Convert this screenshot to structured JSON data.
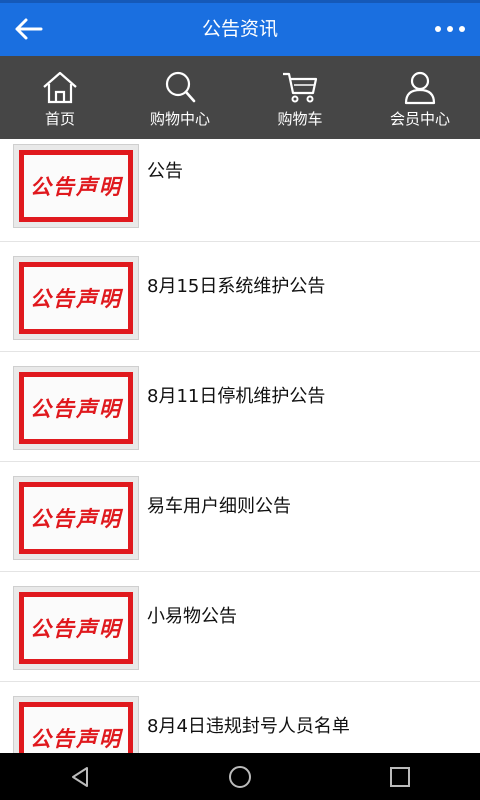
{
  "header": {
    "title": "公告资讯"
  },
  "nav": {
    "items": [
      {
        "label": "首页",
        "icon": "home-icon"
      },
      {
        "label": "购物中心",
        "icon": "search-icon"
      },
      {
        "label": "购物车",
        "icon": "cart-icon"
      },
      {
        "label": "会员中心",
        "icon": "user-icon"
      }
    ]
  },
  "list": {
    "items": [
      {
        "title": "公告",
        "thumb_text": "公告声明"
      },
      {
        "title": "8月15日系统维护公告",
        "thumb_text": "公告声明"
      },
      {
        "title": "8月11日停机维护公告",
        "thumb_text": "公告声明"
      },
      {
        "title": "易车用户细则公告",
        "thumb_text": "公告声明"
      },
      {
        "title": "小易物公告",
        "thumb_text": "公告声明"
      },
      {
        "title": "8月4日违规封号人员名单",
        "thumb_text": "公告声明"
      }
    ]
  },
  "colors": {
    "header_bg": "#1a6fe0",
    "nav_bg": "#464646",
    "stamp_red": "#e0191e"
  }
}
